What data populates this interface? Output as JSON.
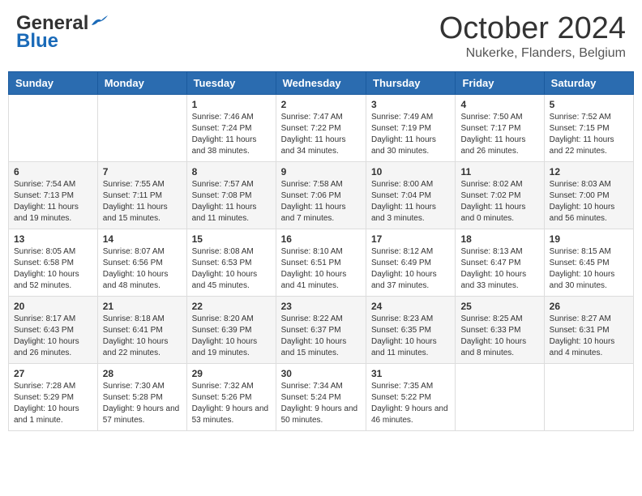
{
  "header": {
    "logo_general": "General",
    "logo_blue": "Blue",
    "month_title": "October 2024",
    "location": "Nukerke, Flanders, Belgium"
  },
  "columns": [
    "Sunday",
    "Monday",
    "Tuesday",
    "Wednesday",
    "Thursday",
    "Friday",
    "Saturday"
  ],
  "weeks": [
    [
      {
        "day": "",
        "sunrise": "",
        "sunset": "",
        "daylight": ""
      },
      {
        "day": "",
        "sunrise": "",
        "sunset": "",
        "daylight": ""
      },
      {
        "day": "1",
        "sunrise": "Sunrise: 7:46 AM",
        "sunset": "Sunset: 7:24 PM",
        "daylight": "Daylight: 11 hours and 38 minutes."
      },
      {
        "day": "2",
        "sunrise": "Sunrise: 7:47 AM",
        "sunset": "Sunset: 7:22 PM",
        "daylight": "Daylight: 11 hours and 34 minutes."
      },
      {
        "day": "3",
        "sunrise": "Sunrise: 7:49 AM",
        "sunset": "Sunset: 7:19 PM",
        "daylight": "Daylight: 11 hours and 30 minutes."
      },
      {
        "day": "4",
        "sunrise": "Sunrise: 7:50 AM",
        "sunset": "Sunset: 7:17 PM",
        "daylight": "Daylight: 11 hours and 26 minutes."
      },
      {
        "day": "5",
        "sunrise": "Sunrise: 7:52 AM",
        "sunset": "Sunset: 7:15 PM",
        "daylight": "Daylight: 11 hours and 22 minutes."
      }
    ],
    [
      {
        "day": "6",
        "sunrise": "Sunrise: 7:54 AM",
        "sunset": "Sunset: 7:13 PM",
        "daylight": "Daylight: 11 hours and 19 minutes."
      },
      {
        "day": "7",
        "sunrise": "Sunrise: 7:55 AM",
        "sunset": "Sunset: 7:11 PM",
        "daylight": "Daylight: 11 hours and 15 minutes."
      },
      {
        "day": "8",
        "sunrise": "Sunrise: 7:57 AM",
        "sunset": "Sunset: 7:08 PM",
        "daylight": "Daylight: 11 hours and 11 minutes."
      },
      {
        "day": "9",
        "sunrise": "Sunrise: 7:58 AM",
        "sunset": "Sunset: 7:06 PM",
        "daylight": "Daylight: 11 hours and 7 minutes."
      },
      {
        "day": "10",
        "sunrise": "Sunrise: 8:00 AM",
        "sunset": "Sunset: 7:04 PM",
        "daylight": "Daylight: 11 hours and 3 minutes."
      },
      {
        "day": "11",
        "sunrise": "Sunrise: 8:02 AM",
        "sunset": "Sunset: 7:02 PM",
        "daylight": "Daylight: 11 hours and 0 minutes."
      },
      {
        "day": "12",
        "sunrise": "Sunrise: 8:03 AM",
        "sunset": "Sunset: 7:00 PM",
        "daylight": "Daylight: 10 hours and 56 minutes."
      }
    ],
    [
      {
        "day": "13",
        "sunrise": "Sunrise: 8:05 AM",
        "sunset": "Sunset: 6:58 PM",
        "daylight": "Daylight: 10 hours and 52 minutes."
      },
      {
        "day": "14",
        "sunrise": "Sunrise: 8:07 AM",
        "sunset": "Sunset: 6:56 PM",
        "daylight": "Daylight: 10 hours and 48 minutes."
      },
      {
        "day": "15",
        "sunrise": "Sunrise: 8:08 AM",
        "sunset": "Sunset: 6:53 PM",
        "daylight": "Daylight: 10 hours and 45 minutes."
      },
      {
        "day": "16",
        "sunrise": "Sunrise: 8:10 AM",
        "sunset": "Sunset: 6:51 PM",
        "daylight": "Daylight: 10 hours and 41 minutes."
      },
      {
        "day": "17",
        "sunrise": "Sunrise: 8:12 AM",
        "sunset": "Sunset: 6:49 PM",
        "daylight": "Daylight: 10 hours and 37 minutes."
      },
      {
        "day": "18",
        "sunrise": "Sunrise: 8:13 AM",
        "sunset": "Sunset: 6:47 PM",
        "daylight": "Daylight: 10 hours and 33 minutes."
      },
      {
        "day": "19",
        "sunrise": "Sunrise: 8:15 AM",
        "sunset": "Sunset: 6:45 PM",
        "daylight": "Daylight: 10 hours and 30 minutes."
      }
    ],
    [
      {
        "day": "20",
        "sunrise": "Sunrise: 8:17 AM",
        "sunset": "Sunset: 6:43 PM",
        "daylight": "Daylight: 10 hours and 26 minutes."
      },
      {
        "day": "21",
        "sunrise": "Sunrise: 8:18 AM",
        "sunset": "Sunset: 6:41 PM",
        "daylight": "Daylight: 10 hours and 22 minutes."
      },
      {
        "day": "22",
        "sunrise": "Sunrise: 8:20 AM",
        "sunset": "Sunset: 6:39 PM",
        "daylight": "Daylight: 10 hours and 19 minutes."
      },
      {
        "day": "23",
        "sunrise": "Sunrise: 8:22 AM",
        "sunset": "Sunset: 6:37 PM",
        "daylight": "Daylight: 10 hours and 15 minutes."
      },
      {
        "day": "24",
        "sunrise": "Sunrise: 8:23 AM",
        "sunset": "Sunset: 6:35 PM",
        "daylight": "Daylight: 10 hours and 11 minutes."
      },
      {
        "day": "25",
        "sunrise": "Sunrise: 8:25 AM",
        "sunset": "Sunset: 6:33 PM",
        "daylight": "Daylight: 10 hours and 8 minutes."
      },
      {
        "day": "26",
        "sunrise": "Sunrise: 8:27 AM",
        "sunset": "Sunset: 6:31 PM",
        "daylight": "Daylight: 10 hours and 4 minutes."
      }
    ],
    [
      {
        "day": "27",
        "sunrise": "Sunrise: 7:28 AM",
        "sunset": "Sunset: 5:29 PM",
        "daylight": "Daylight: 10 hours and 1 minute."
      },
      {
        "day": "28",
        "sunrise": "Sunrise: 7:30 AM",
        "sunset": "Sunset: 5:28 PM",
        "daylight": "Daylight: 9 hours and 57 minutes."
      },
      {
        "day": "29",
        "sunrise": "Sunrise: 7:32 AM",
        "sunset": "Sunset: 5:26 PM",
        "daylight": "Daylight: 9 hours and 53 minutes."
      },
      {
        "day": "30",
        "sunrise": "Sunrise: 7:34 AM",
        "sunset": "Sunset: 5:24 PM",
        "daylight": "Daylight: 9 hours and 50 minutes."
      },
      {
        "day": "31",
        "sunrise": "Sunrise: 7:35 AM",
        "sunset": "Sunset: 5:22 PM",
        "daylight": "Daylight: 9 hours and 46 minutes."
      },
      {
        "day": "",
        "sunrise": "",
        "sunset": "",
        "daylight": ""
      },
      {
        "day": "",
        "sunrise": "",
        "sunset": "",
        "daylight": ""
      }
    ]
  ]
}
